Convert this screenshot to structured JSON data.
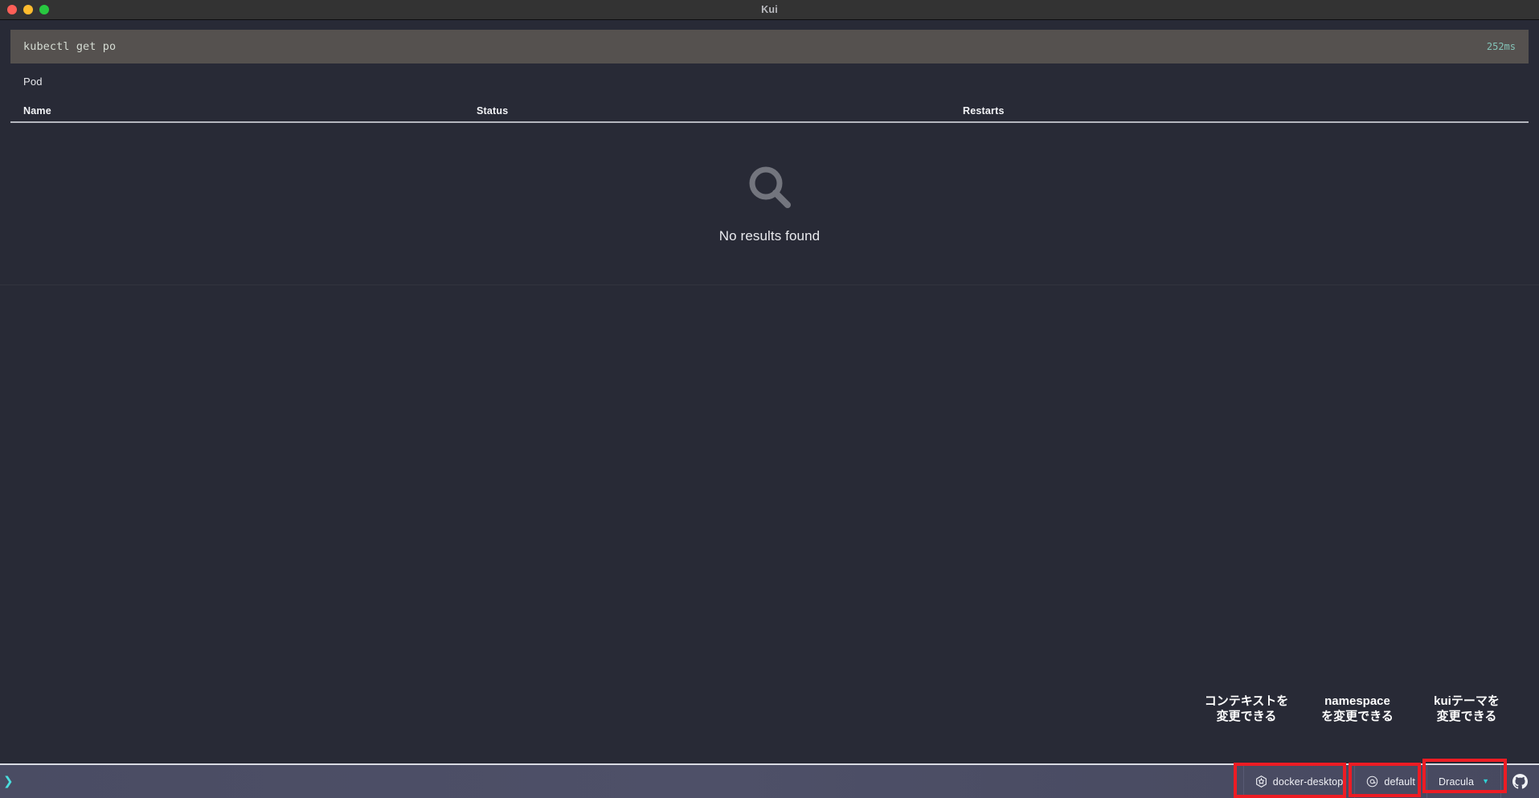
{
  "window": {
    "title": "Kui",
    "traffic_lights": [
      {
        "name": "close",
        "color": "#ff5f57"
      },
      {
        "name": "minimize",
        "color": "#febc2e"
      },
      {
        "name": "maximize",
        "color": "#28c840"
      }
    ]
  },
  "command_block": {
    "command": "kubectl get po",
    "duration": "252ms"
  },
  "result": {
    "kind": "Pod",
    "columns": [
      "Name",
      "Status",
      "Restarts"
    ],
    "rows": [],
    "empty_state": {
      "icon": "search-icon",
      "message": "No results found"
    }
  },
  "annotations": [
    {
      "text": "コンテキストを\n変更できる",
      "target": "context-button"
    },
    {
      "text": "namespace\nを変更できる",
      "target": "namespace-button"
    },
    {
      "text": "kuiテーマを\n変更できる",
      "target": "theme-button"
    }
  ],
  "statusbar": {
    "prompt_icon": "chevron-right-icon",
    "context": {
      "icon": "kubernetes-icon",
      "label": "docker-desktop"
    },
    "namespace": {
      "icon": "at-sign-icon",
      "label": "default"
    },
    "theme": {
      "label": "Dracula",
      "caret": "▼"
    },
    "github": {
      "icon": "github-icon"
    }
  },
  "colors": {
    "background": "#282a36",
    "titlebar": "#333333",
    "command_bar": "#55514f",
    "statusbar": "#4a4c63",
    "accent_cyan": "#2fd2d6",
    "duration_text": "#84c4b8",
    "highlight_box": "#ed1c24"
  }
}
